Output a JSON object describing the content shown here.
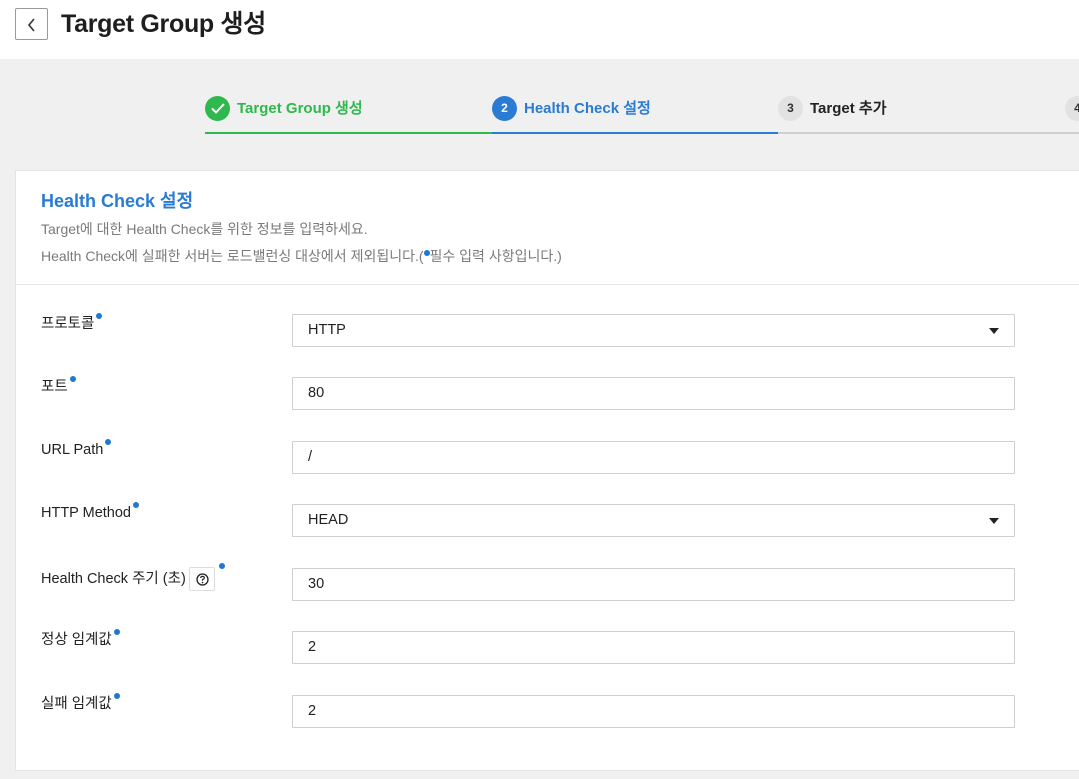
{
  "header": {
    "title": "Target Group 생성"
  },
  "stepper": {
    "steps": [
      {
        "number": "1",
        "label": "Target Group 생성",
        "state": "done"
      },
      {
        "number": "2",
        "label": "Health Check 설정",
        "state": "active"
      },
      {
        "number": "3",
        "label": "Target 추가",
        "state": "todo"
      },
      {
        "number": "4",
        "label": "",
        "state": "todo"
      }
    ]
  },
  "section": {
    "title": "Health Check 설정",
    "desc1": "Target에 대한 Health Check를 위한 정보를 입력하세요.",
    "desc2_pre": "Health Check에 실패한 서버는 로드밸런싱 대상에서 제외됩니다.(",
    "desc2_post": "필수 입력 사항입니다.)"
  },
  "form": {
    "protocol": {
      "label": "프로토콜",
      "value": "HTTP"
    },
    "port": {
      "label": "포트",
      "value": "80"
    },
    "url_path": {
      "label": "URL Path",
      "value": "/"
    },
    "http_method": {
      "label": "HTTP Method",
      "value": "HEAD"
    },
    "interval": {
      "label": "Health Check 주기 (초)",
      "value": "30"
    },
    "healthy_threshold": {
      "label": "정상 임계값",
      "value": "2"
    },
    "unhealthy_threshold": {
      "label": "실패 임계값",
      "value": "2"
    }
  },
  "colors": {
    "accent": "#2a7bd4",
    "success": "#2fb84d",
    "required_dot": "#1f78d1"
  }
}
